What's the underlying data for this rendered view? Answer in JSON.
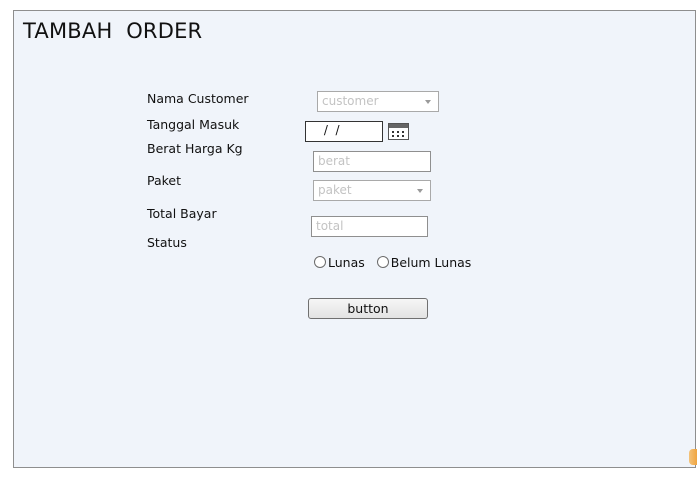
{
  "form": {
    "title": "TAMBAH  ORDER",
    "nama_customer": {
      "label": "Nama Customer",
      "placeholder": "customer"
    },
    "tanggal_masuk": {
      "label": "Tanggal Masuk",
      "value": " /  / "
    },
    "berat": {
      "label": "Berat Harga Kg",
      "placeholder": "berat"
    },
    "paket": {
      "label": "Paket",
      "placeholder": "paket"
    },
    "total": {
      "label": "Total Bayar",
      "placeholder": "total"
    },
    "status": {
      "label": "Status",
      "options": [
        "Lunas",
        "Belum Lunas"
      ]
    },
    "button_label": "button"
  },
  "icons": {
    "calendar": "calendar-icon",
    "dropdown": "chevron-down-icon"
  }
}
